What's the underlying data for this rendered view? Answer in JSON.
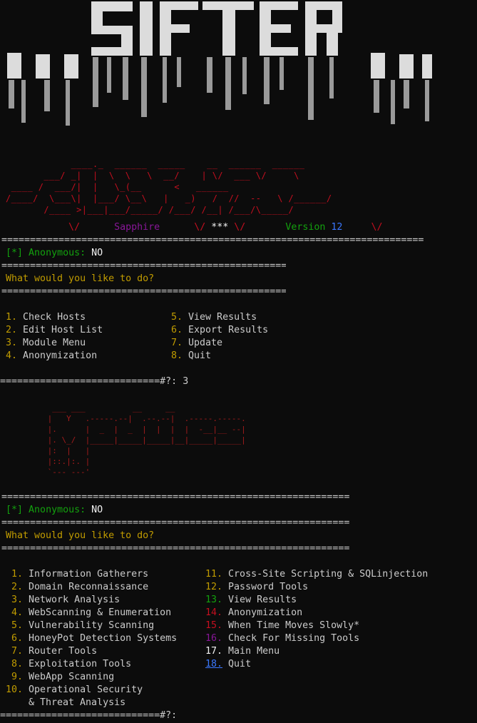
{
  "banner_logo": "SIFTER",
  "silent_logo": "SILENT78",
  "banner_info": {
    "codename": "Sapphire",
    "stars": "***",
    "version_label": "Version",
    "version_number": "12"
  },
  "anonymous_status": {
    "bracket": "[*]",
    "label": "Anonymous:",
    "value": "NO"
  },
  "prompt_question": "What would you like to do?",
  "main_menu": {
    "left": [
      {
        "num": "1.",
        "label": "Check Hosts"
      },
      {
        "num": "2.",
        "label": "Edit Host List"
      },
      {
        "num": "3.",
        "label": "Module Menu"
      },
      {
        "num": "4.",
        "label": "Anonymization"
      }
    ],
    "right": [
      {
        "num": "5.",
        "label": "View Results"
      },
      {
        "num": "6.",
        "label": "Export Results"
      },
      {
        "num": "7.",
        "label": "Update"
      },
      {
        "num": "8.",
        "label": "Quit"
      }
    ]
  },
  "main_prompt": {
    "prefix": "============================#?:",
    "input": "3"
  },
  "modules_logo": "Modules",
  "anonymous_status_2": {
    "bracket": "[*]",
    "label": "Anonymous:",
    "value": "NO"
  },
  "prompt_question_2": "What would you like to do?",
  "module_menu": {
    "left": [
      {
        "num": "1.",
        "label": "Information Gatherers",
        "color": "#c19c00"
      },
      {
        "num": "2.",
        "label": "Domain Reconnaissance",
        "color": "#c19c00"
      },
      {
        "num": "3.",
        "label": "Network Analysis",
        "color": "#c19c00"
      },
      {
        "num": "4.",
        "label": "WebScanning & Enumeration",
        "color": "#c19c00"
      },
      {
        "num": "5.",
        "label": "Vulnerability Scanning",
        "color": "#c19c00"
      },
      {
        "num": "6.",
        "label": "HoneyPot Detection Systems",
        "color": "#c19c00"
      },
      {
        "num": "7.",
        "label": "Router Tools",
        "color": "#c19c00"
      },
      {
        "num": "8.",
        "label": "Exploitation Tools",
        "color": "#c19c00"
      },
      {
        "num": "9.",
        "label": "WebApp Scanning",
        "color": "#c19c00"
      },
      {
        "num": "10.",
        "label": "Operational Security",
        "color": "#c19c00"
      }
    ],
    "left_continuation": "& Threat Analysis",
    "right": [
      {
        "num": "11.",
        "label": "Cross-Site Scripting & SQLinjection",
        "color": "#c19c00"
      },
      {
        "num": "12.",
        "label": "Password Tools",
        "color": "#c19c00"
      },
      {
        "num": "13.",
        "label": "View Results",
        "color": "#13a10e"
      },
      {
        "num": "14.",
        "label": "Anonymization",
        "color": "#c50f1f"
      },
      {
        "num": "15.",
        "label": "When Time Moves Slowly*",
        "color": "#c50f1f"
      },
      {
        "num": "16.",
        "label": "Check For Missing Tools",
        "color": "#881798"
      },
      {
        "num": "17.",
        "label": "Main Menu",
        "color": "#f2f2f2"
      },
      {
        "num": "18.",
        "label": "Quit",
        "color": "#3b78ff"
      }
    ]
  },
  "module_prompt": {
    "prefix": "============================#?:",
    "input": ""
  },
  "colors": {
    "background": "#0c0c0c",
    "foreground": "#cccccc",
    "green": "#13a10e",
    "yellow": "#c19c00",
    "red": "#c50f1f",
    "purple": "#881798",
    "blue": "#3b78ff"
  }
}
